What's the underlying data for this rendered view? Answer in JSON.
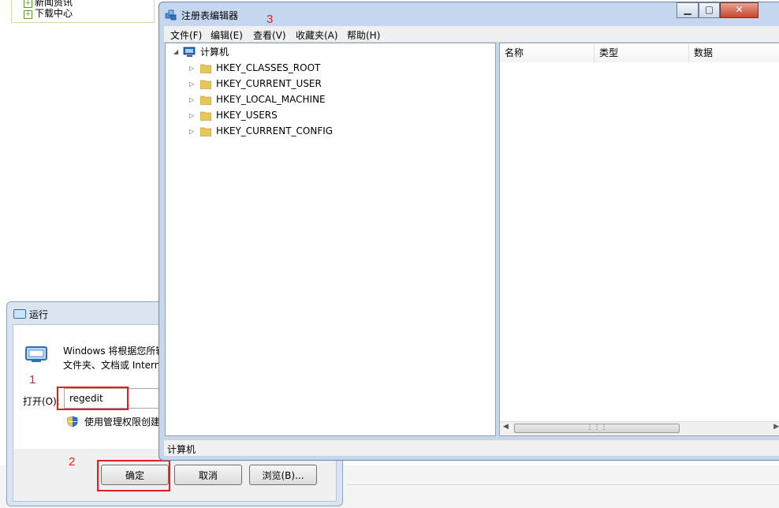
{
  "background_page": {
    "tree_items": [
      "新闻资讯",
      "下载中心"
    ]
  },
  "run_dialog": {
    "title": "运行",
    "description_line1": "Windows 将根据您所输入的名称，为您打开相应的程序、",
    "description_line2": "文件夹、文档或 Internet 资源。",
    "open_label": "打开(O):",
    "input_value": "regedit",
    "admin_note": "使用管理权限创建此任务。",
    "ok_label": "确定",
    "cancel_label": "取消",
    "browse_label": "浏览(B)..."
  },
  "annotations": [
    "1",
    "2",
    "3"
  ],
  "annotation_color": "#e02020",
  "registry_editor": {
    "title": "注册表编辑器",
    "menu": [
      "文件(F)",
      "编辑(E)",
      "查看(V)",
      "收藏夹(A)",
      "帮助(H)"
    ],
    "tree": {
      "root": "计算机",
      "children": [
        "HKEY_CLASSES_ROOT",
        "HKEY_CURRENT_USER",
        "HKEY_LOCAL_MACHINE",
        "HKEY_USERS",
        "HKEY_CURRENT_CONFIG"
      ]
    },
    "columns": [
      "名称",
      "类型",
      "数据"
    ],
    "status": "计算机"
  }
}
